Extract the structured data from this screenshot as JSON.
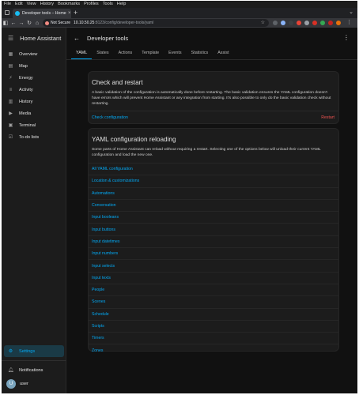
{
  "browser": {
    "menu": [
      "File",
      "Edit",
      "View",
      "History",
      "Bookmarks",
      "Profiles",
      "Tools",
      "Help"
    ],
    "tab_title": "Developer tools – Home Assistant",
    "tab_close": "×",
    "new_tab": "+",
    "security_label": "Not Secure",
    "url_host": "10.10.50.25",
    "url_rest": ":8123/config/developer-tools/yaml"
  },
  "sidebar": {
    "title": "Home Assistant",
    "items": [
      {
        "label": "Overview",
        "icon": "overview-icon",
        "glyph": "▦"
      },
      {
        "label": "Map",
        "icon": "map-icon",
        "glyph": "▤"
      },
      {
        "label": "Energy",
        "icon": "energy-icon",
        "glyph": "⚡"
      },
      {
        "label": "Activity",
        "icon": "activity-icon",
        "glyph": "≡"
      },
      {
        "label": "History",
        "icon": "history-icon",
        "glyph": "▥"
      },
      {
        "label": "Media",
        "icon": "media-icon",
        "glyph": "▶"
      },
      {
        "label": "Terminal",
        "icon": "terminal-icon",
        "glyph": "▣"
      },
      {
        "label": "To-do lists",
        "icon": "todo-icon",
        "glyph": "☑"
      }
    ],
    "settings_label": "Settings",
    "notifications_label": "Notifications",
    "user_label": "user",
    "user_initial": "U"
  },
  "main": {
    "title": "Developer tools",
    "tabs": [
      "YAML",
      "States",
      "Actions",
      "Template",
      "Events",
      "Statistics",
      "Assist"
    ],
    "active_tab": "YAML"
  },
  "check_card": {
    "title": "Check and restart",
    "description": "A basic validation of the configuration is automatically done before restarting. The basic validation ensures the YAML configuration doesn't have errors which will prevent Home Assistant or any integration from starting. It's also possible to only do the basic validation check without restarting.",
    "check_label": "Check configuration",
    "restart_label": "Restart"
  },
  "reload_card": {
    "title": "YAML configuration reloading",
    "description": "Some parts of Home Assistant can reload without requiring a restart. Selecting one of the options below will unload their current YAML configuration and load the new one.",
    "items": [
      "All YAML configuration",
      "Location & customizations",
      "Automations",
      "Conversation",
      "Input booleans",
      "Input buttons",
      "Input datetimes",
      "Input numbers",
      "Input selects",
      "Input texts",
      "People",
      "Scenes",
      "Schedule",
      "Scripts",
      "Timers",
      "Zones"
    ]
  },
  "colors": {
    "accent": "#03a9f4",
    "danger": "#ef5350",
    "background": "#111111",
    "card": "#1c1c1c"
  }
}
